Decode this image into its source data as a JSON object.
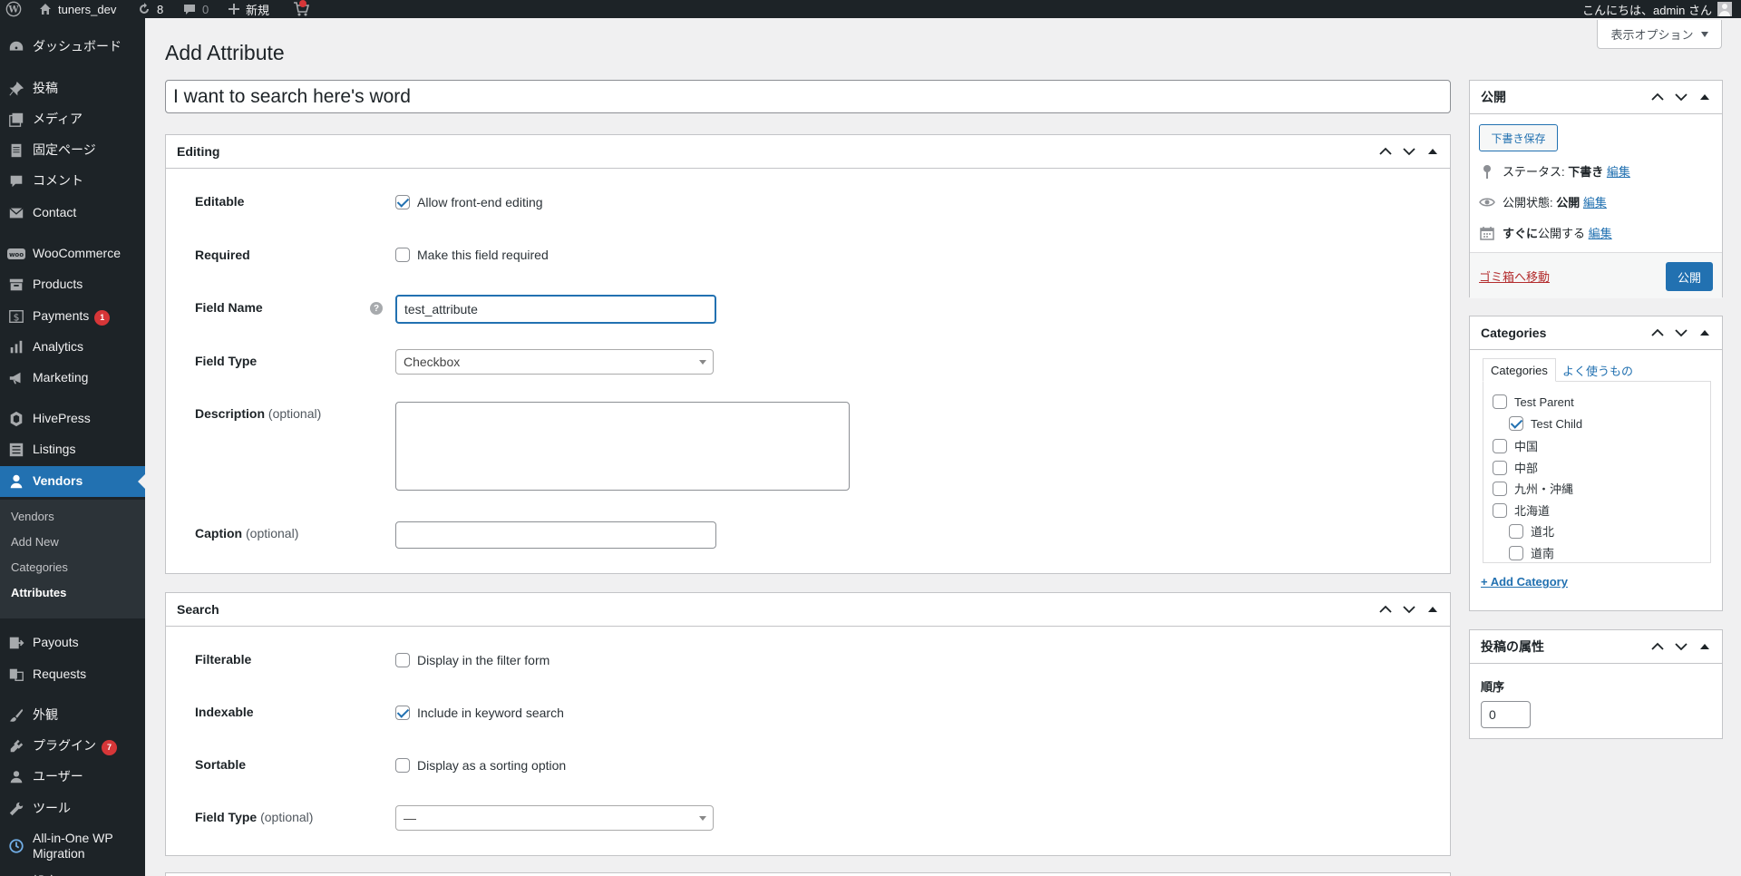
{
  "admin_bar": {
    "site_name": "tuners_dev",
    "updates_count": "8",
    "comments_count": "0",
    "new_label": "新規",
    "greeting": "こんにちは、admin さん"
  },
  "sidebar": {
    "items": [
      {
        "label": "ダッシュボード",
        "icon": "dashboard-icon"
      },
      {
        "label": "投稿",
        "icon": "pin-icon"
      },
      {
        "label": "メディア",
        "icon": "media-icon"
      },
      {
        "label": "固定ページ",
        "icon": "page-icon"
      },
      {
        "label": "コメント",
        "icon": "comment-icon"
      },
      {
        "label": "Contact",
        "icon": "mail-icon"
      },
      {
        "label": "WooCommerce",
        "icon": "woo-icon"
      },
      {
        "label": "Products",
        "icon": "archive-icon"
      },
      {
        "label": "Payments",
        "icon": "dollar-icon",
        "badge": "1"
      },
      {
        "label": "Analytics",
        "icon": "chart-icon"
      },
      {
        "label": "Marketing",
        "icon": "megaphone-icon"
      },
      {
        "label": "HivePress",
        "icon": "hive-icon"
      },
      {
        "label": "Listings",
        "icon": "list-icon"
      },
      {
        "label": "Vendors",
        "icon": "user-icon"
      },
      {
        "label": "Payouts",
        "icon": "payout-icon"
      },
      {
        "label": "Requests",
        "icon": "request-icon"
      },
      {
        "label": "外観",
        "icon": "brush-icon"
      },
      {
        "label": "プラグイン",
        "icon": "plugin-icon",
        "badge": "7"
      },
      {
        "label": "ユーザー",
        "icon": "users-icon"
      },
      {
        "label": "ツール",
        "icon": "tools-icon"
      },
      {
        "label": "All-in-One WP Migration",
        "icon": "migration-icon"
      },
      {
        "label": "設定",
        "icon": "settings-icon"
      }
    ],
    "submenu": [
      "Vendors",
      "Add New",
      "Categories",
      "Attributes"
    ]
  },
  "page": {
    "title": "Add Attribute",
    "screen_options": "表示オプション",
    "post_title": "I want to search here's word"
  },
  "editing_box": {
    "title": "Editing",
    "editable_label": "Editable",
    "editable_text": "Allow front-end editing",
    "required_label": "Required",
    "required_text": "Make this field required",
    "field_name_label": "Field Name",
    "field_name_value": "test_attribute",
    "field_type_label": "Field Type",
    "field_type_value": "Checkbox",
    "description_label": "Description",
    "caption_label": "Caption",
    "optional": "(optional)"
  },
  "search_box": {
    "title": "Search",
    "filterable_label": "Filterable",
    "filterable_text": "Display in the filter form",
    "indexable_label": "Indexable",
    "indexable_text": "Include in keyword search",
    "sortable_label": "Sortable",
    "sortable_text": "Display as a sorting option",
    "field_type_label": "Field Type",
    "field_type_value": "—",
    "optional": "(optional)"
  },
  "publish_box": {
    "title": "公開",
    "save_draft": "下書き保存",
    "status_label": "ステータス:",
    "status_value": "下書き",
    "visibility_label": "公開状態:",
    "visibility_value": "公開",
    "schedule_bold": "すぐに",
    "schedule_text": "公開する",
    "edit": "編集",
    "trash": "ゴミ箱へ移動",
    "publish": "公開"
  },
  "categories_box": {
    "title": "Categories",
    "tab_all": "Categories",
    "tab_popular": "よく使うもの",
    "items": [
      {
        "label": "Test Parent",
        "checked": false,
        "level": 0
      },
      {
        "label": "Test Child",
        "checked": true,
        "level": 1
      },
      {
        "label": "中国",
        "checked": false,
        "level": 0
      },
      {
        "label": "中部",
        "checked": false,
        "level": 0
      },
      {
        "label": "九州・沖縄",
        "checked": false,
        "level": 0
      },
      {
        "label": "北海道",
        "checked": false,
        "level": 0
      },
      {
        "label": "道北",
        "checked": false,
        "level": 1
      },
      {
        "label": "道南",
        "checked": false,
        "level": 1
      }
    ],
    "add_category": "+ Add Category"
  },
  "attributes_box": {
    "title": "投稿の属性",
    "order_label": "順序",
    "order_value": "0"
  }
}
